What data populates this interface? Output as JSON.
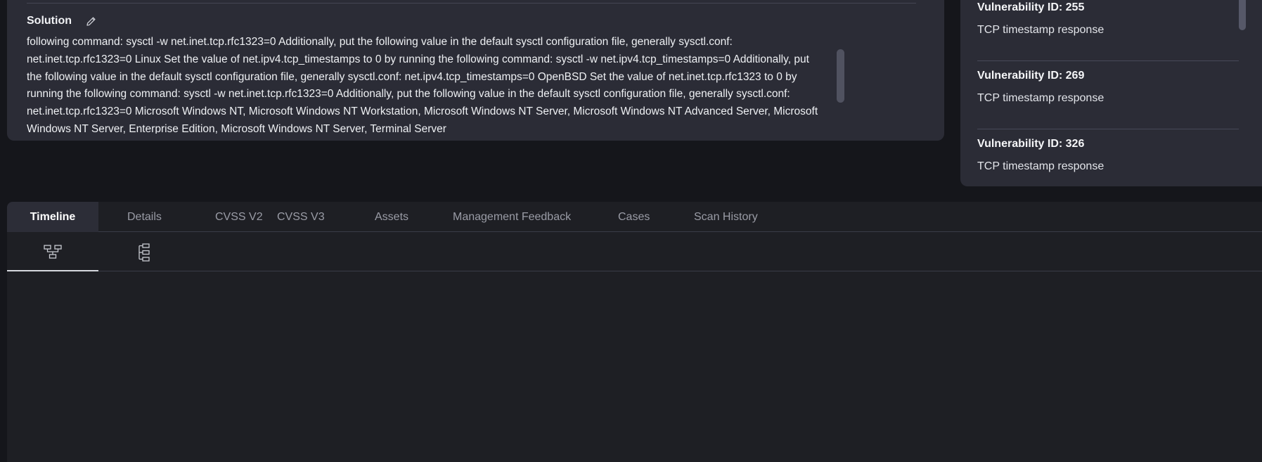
{
  "solution": {
    "title": "Solution",
    "text": "following command: sysctl -w net.inet.tcp.rfc1323=0 Additionally, put the following value in the default sysctl configuration file, generally sysctl.conf: net.inet.tcp.rfc1323=0 Linux Set the value of net.ipv4.tcp_timestamps to 0 by running the following command: sysctl -w net.ipv4.tcp_timestamps=0 Additionally, put the following value in the default sysctl configuration file, generally sysctl.conf: net.ipv4.tcp_timestamps=0 OpenBSD Set the value of net.inet.tcp.rfc1323 to 0 by running the following command: sysctl -w net.inet.tcp.rfc1323=0 Additionally, put the following value in the default sysctl configuration file, generally sysctl.conf: net.inet.tcp.rfc1323=0 Microsoft Windows NT, Microsoft Windows NT Workstation, Microsoft Windows NT Server, Microsoft Windows NT Advanced Server, Microsoft Windows NT Server, Enterprise Edition, Microsoft Windows NT Server, Terminal Server"
  },
  "related_vulnerabilities": [
    {
      "id_label": "Vulnerability ID: 255",
      "description": "TCP timestamp response"
    },
    {
      "id_label": "Vulnerability ID: 269",
      "description": "TCP timestamp response"
    },
    {
      "id_label": "Vulnerability ID: 326",
      "description": "TCP timestamp response"
    }
  ],
  "tabs": [
    {
      "label": "Timeline",
      "active": true
    },
    {
      "label": "Details"
    },
    {
      "label": "CVSS V2"
    },
    {
      "label": "CVSS V3"
    },
    {
      "label": "Assets"
    },
    {
      "label": "Management Feedback"
    },
    {
      "label": "Cases"
    },
    {
      "label": "Scan History"
    }
  ],
  "timeline_views": [
    {
      "icon": "tree-horizontal-icon",
      "active": true
    },
    {
      "icon": "tree-vertical-icon",
      "active": false
    }
  ]
}
